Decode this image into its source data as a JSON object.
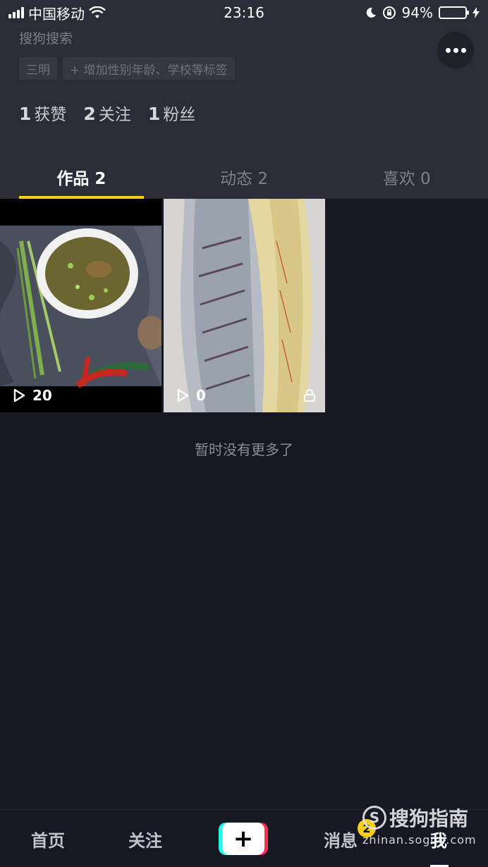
{
  "status_bar": {
    "carrier": "中国移动",
    "time": "23:16",
    "battery_percent": "94%",
    "battery_level": 0.94
  },
  "profile": {
    "user_id": "搜狗搜索",
    "tags": [
      "三明",
      "+ 增加性别年龄、学校等标签"
    ],
    "stats": [
      {
        "num": "1",
        "label": "获赞"
      },
      {
        "num": "2",
        "label": "关注"
      },
      {
        "num": "1",
        "label": "粉丝"
      }
    ]
  },
  "tabs": [
    {
      "label": "作品 2",
      "active": true
    },
    {
      "label": "动态 2",
      "active": false
    },
    {
      "label": "喜欢 0",
      "active": false
    }
  ],
  "videos": [
    {
      "plays": "20",
      "locked": false,
      "icon": "play-icon"
    },
    {
      "plays": "0",
      "locked": true,
      "icon": "play-icon"
    }
  ],
  "feed": {
    "end_text": "暂时没有更多了"
  },
  "bottom_nav": {
    "home": "首页",
    "follow": "关注",
    "add": "+",
    "messages": "消息",
    "messages_badge": "2",
    "me": "我"
  },
  "watermark": {
    "logo": "S",
    "title": "搜狗指南",
    "url": "zhinan.sogou.com"
  },
  "colors": {
    "accent": "#face15",
    "background": "#161823",
    "header": "#2a2c36"
  }
}
